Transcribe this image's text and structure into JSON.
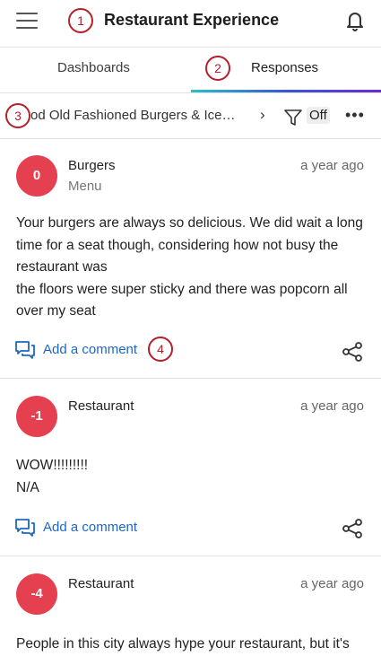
{
  "header": {
    "title": "Restaurant Experience",
    "menu_icon": "hamburger-menu-icon",
    "bell_icon": "bell-icon"
  },
  "callouts": [
    "1",
    "2",
    "3",
    "4"
  ],
  "tabs": [
    {
      "label": "Dashboards"
    },
    {
      "label": "Responses",
      "active": true
    }
  ],
  "breadcrumb": {
    "text": "Good Old Fashioned Burgers & Ice…",
    "filter_label": "Off",
    "more_icon": "more-horizontal-icon"
  },
  "colors": {
    "accent_blue": "#1d67c8",
    "avatar_red": "#e5404f",
    "callout_red": "#b5202a"
  },
  "responses": [
    {
      "score": "0",
      "category": "Burgers",
      "subcategory": "Menu",
      "time": "a year ago",
      "text": "Your burgers are always so delicious. We did wait a long time for a seat though, considering how not busy the restaurant was\nthe floors were super sticky and there was popcorn all over my seat",
      "comment_label": "Add a comment"
    },
    {
      "score": "-1",
      "category": "Restaurant",
      "subcategory": "",
      "time": "a year ago",
      "text": "WOW!!!!!!!!!\nN/A",
      "comment_label": "Add a comment"
    },
    {
      "score": "-4",
      "category": "Restaurant",
      "subcategory": "",
      "time": "a year ago",
      "text": "People in this city always hype your restaurant, but it's",
      "comment_label": ""
    }
  ]
}
